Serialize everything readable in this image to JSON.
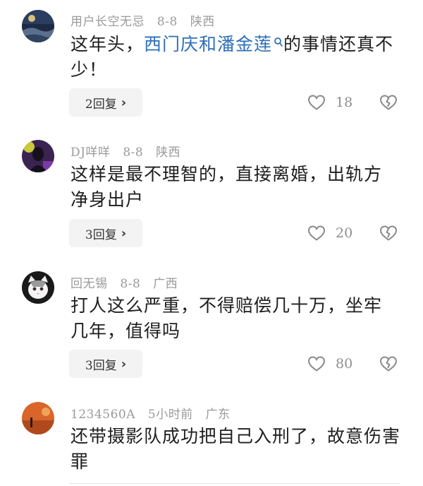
{
  "comments": [
    {
      "username": "用户长空无忌",
      "date": "8-8",
      "location": "陕西",
      "text_before": "这年头，",
      "link_text": "西门庆和潘金莲",
      "text_after": "的事情还真不少！",
      "reply_label": "2回复",
      "likes": "18",
      "avatar_icon": "avatar-night-landscape"
    },
    {
      "username": "DJ咩咩",
      "date": "8-8",
      "location": "陕西",
      "text": "这样是最不理智的，直接离婚，出轨方净身出户",
      "reply_label": "3回复",
      "likes": "20",
      "avatar_icon": "avatar-dark-purple-figure"
    },
    {
      "username": "回无锡",
      "date": "8-8",
      "location": "广西",
      "text": "打人这么严重，不得赔偿几十万，坐牢几年，值得吗",
      "reply_label": "3回复",
      "likes": "80",
      "avatar_icon": "avatar-white-cat"
    },
    {
      "username": "1234560A",
      "date": "5小时前",
      "location": "广东",
      "text": "还带摄影队成功把自己入刑了，故意伤害罪",
      "avatar_icon": "avatar-orange-sunset"
    }
  ],
  "icons": {
    "reply_chevron": "chevron-right-icon",
    "like": "heart-icon",
    "dislike": "broken-heart-icon",
    "link_search": "search-icon"
  },
  "colors": {
    "link": "#2e6fb8",
    "meta": "#9a9a9a",
    "reply_bg": "#f3f3f3"
  }
}
